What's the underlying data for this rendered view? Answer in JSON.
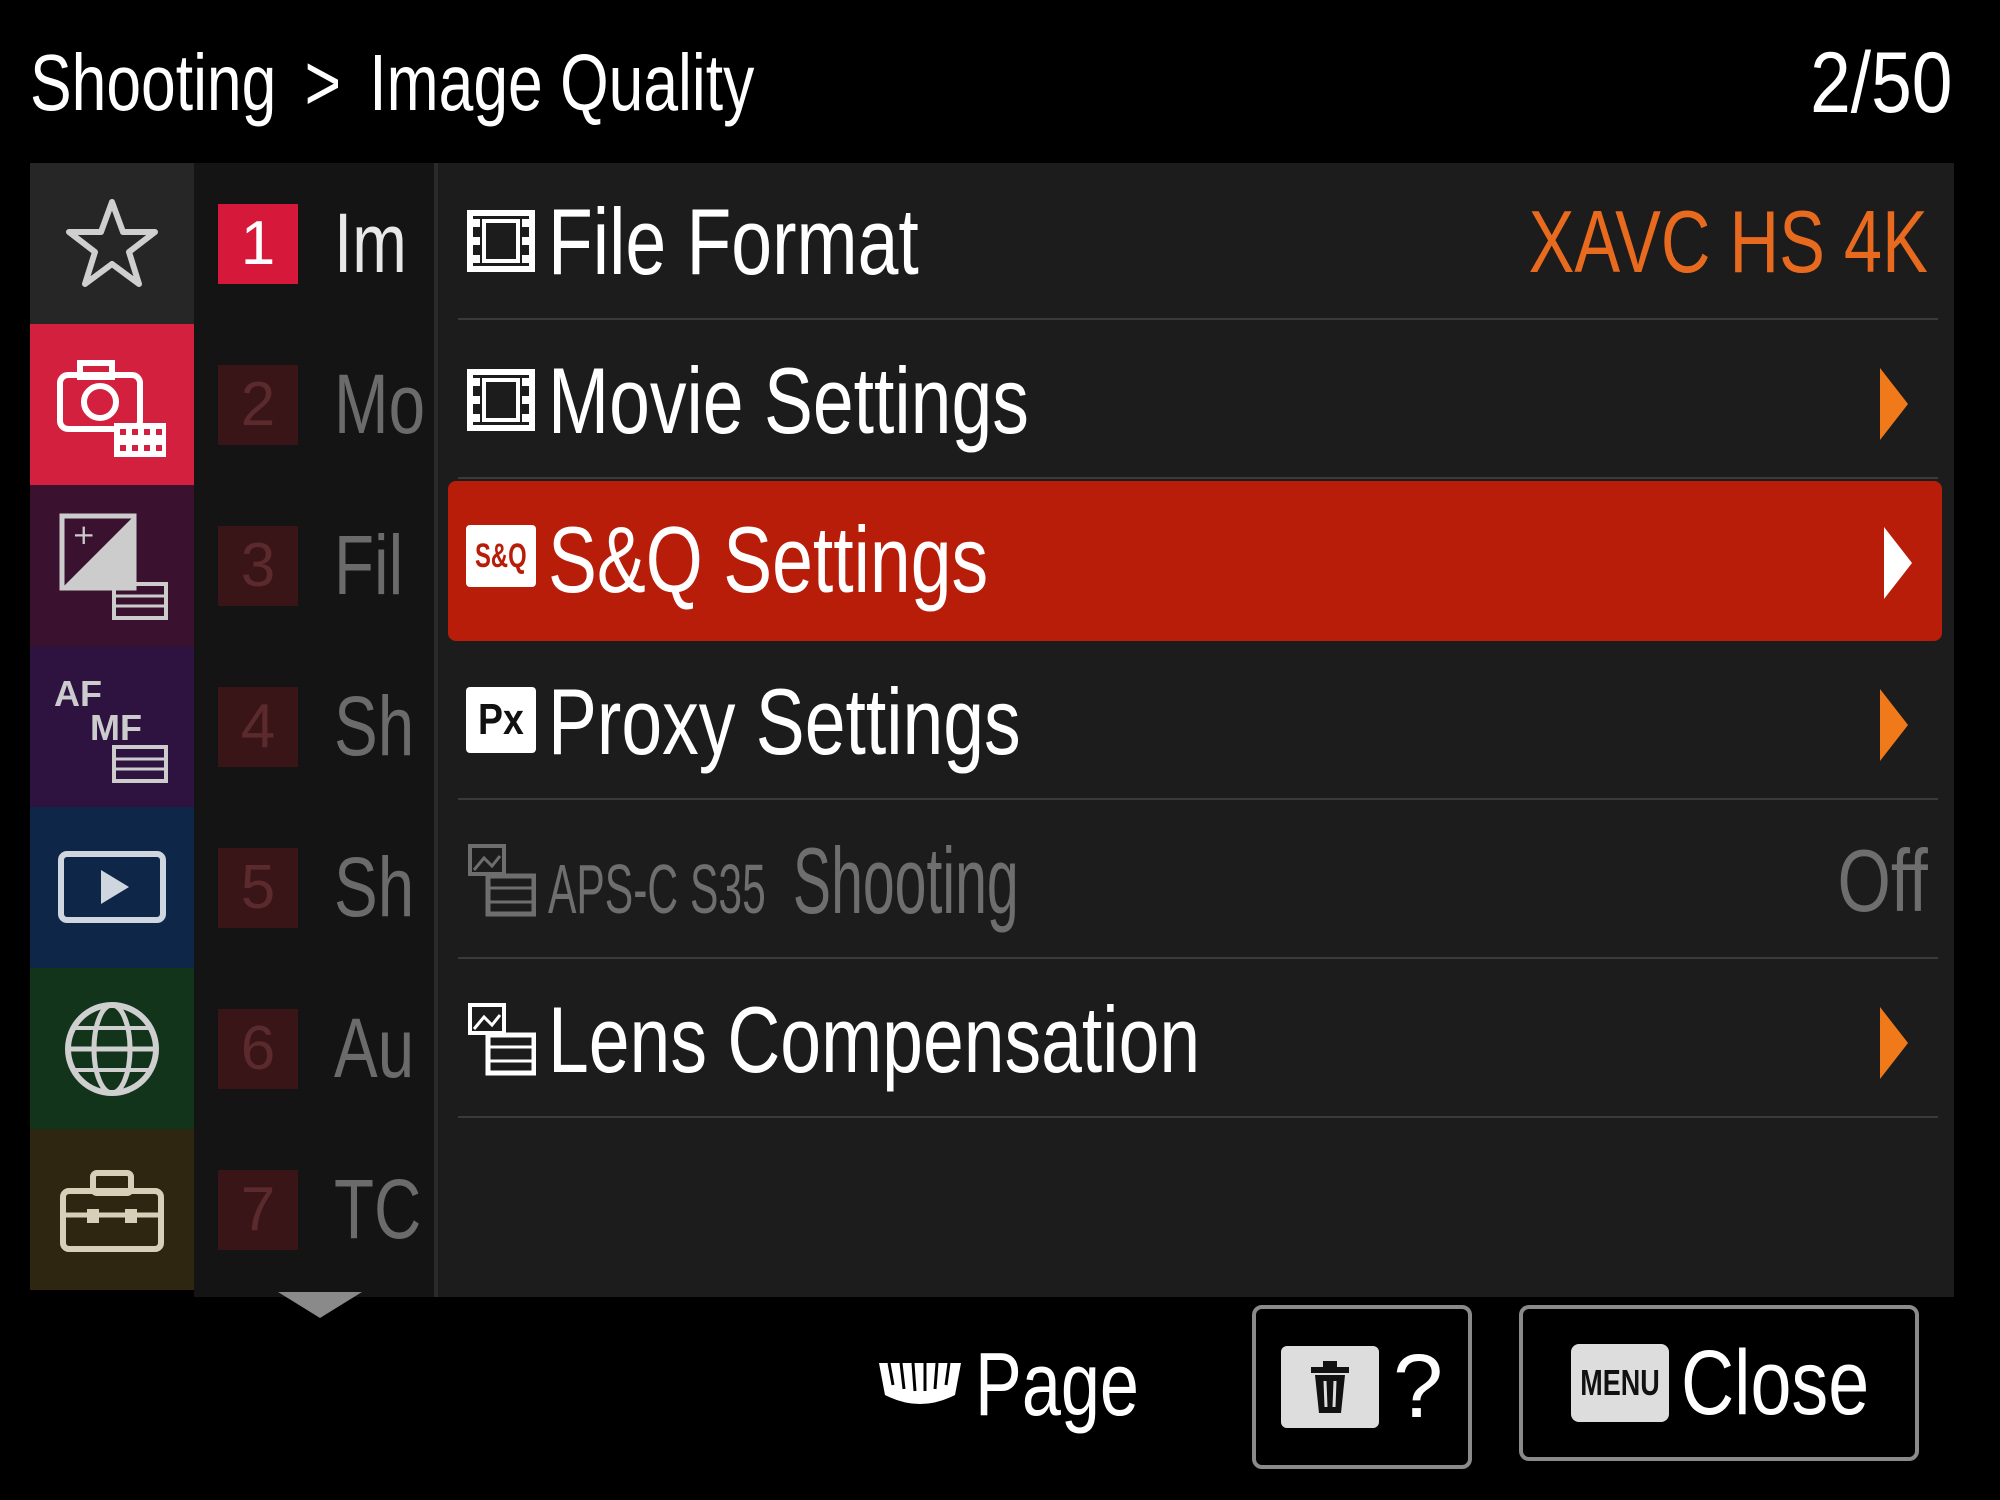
{
  "header": {
    "breadcrumb_parent": "Shooting",
    "breadcrumb_separator": ">",
    "breadcrumb_current": "Image Quality",
    "page_counter": "2/50"
  },
  "categories": [
    {
      "icon": "star-icon",
      "color": "#262626"
    },
    {
      "icon": "camera-movie-icon",
      "color": "#d4203f"
    },
    {
      "icon": "exposure-movie-icon",
      "color": "#3a1230"
    },
    {
      "icon": "af-mf-movie-icon",
      "color": "#2e1340",
      "label_af": "AF",
      "label_mf": "MF"
    },
    {
      "icon": "playback-icon",
      "color": "#0e2647"
    },
    {
      "icon": "network-globe-icon",
      "color": "#12341a"
    },
    {
      "icon": "toolbox-icon",
      "color": "#2e2610"
    }
  ],
  "pages": [
    {
      "num": "1",
      "name": "Im",
      "active": true
    },
    {
      "num": "2",
      "name": "Mo",
      "active": false
    },
    {
      "num": "3",
      "name": "Fil",
      "active": false
    },
    {
      "num": "4",
      "name": "Sh",
      "active": false
    },
    {
      "num": "5",
      "name": "Sh",
      "active": false
    },
    {
      "num": "6",
      "name": "Au",
      "active": false
    },
    {
      "num": "7",
      "name": "TC",
      "active": false
    }
  ],
  "items": [
    {
      "icon": "movie-film-icon",
      "label": "File Format",
      "value": "XAVC HS 4K"
    },
    {
      "icon": "movie-film-icon",
      "label": "Movie Settings",
      "arrow": true
    },
    {
      "icon": "sq-icon",
      "icon_text": "S&Q",
      "label": "S&Q Settings",
      "arrow": true,
      "selected": true
    },
    {
      "icon": "proxy-icon",
      "icon_text": "Px",
      "label": "Proxy Settings",
      "arrow": true
    },
    {
      "icon": "still-movie-icon",
      "prefix": "APS-C S35",
      "label": "Shooting",
      "value": "Off",
      "disabled": true
    },
    {
      "icon": "still-movie-icon",
      "label": "Lens Compensation",
      "arrow": true
    }
  ],
  "footer": {
    "page_label": "Page",
    "help_label": "?",
    "menu_badge": "MENU",
    "close_label": "Close"
  },
  "colors": {
    "accent_selected": "#b81d0a",
    "value_orange": "#e86a1e",
    "active_page": "#d6183a"
  }
}
